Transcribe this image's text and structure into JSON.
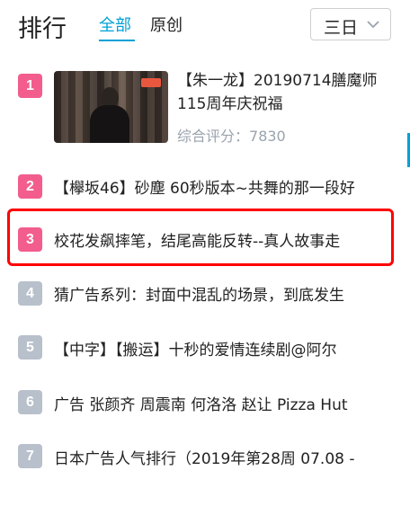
{
  "header": {
    "title": "排行",
    "tabs": [
      {
        "label": "全部",
        "active": true
      },
      {
        "label": "原创",
        "active": false
      }
    ],
    "period_select": {
      "value": "三日"
    }
  },
  "ranking": [
    {
      "rank": "1",
      "title": "【朱一龙】20190714膳魔师115周年庆祝福",
      "score_label": "综合评分：",
      "score": "7830"
    },
    {
      "rank": "2",
      "title": "【欅坂46】砂塵 60秒版本~共舞的那一段好"
    },
    {
      "rank": "3",
      "title": "校花发飙摔笔，结尾高能反转--真人故事走"
    },
    {
      "rank": "4",
      "title": "猜广告系列：封面中混乱的场景，到底发生"
    },
    {
      "rank": "5",
      "title": "【中字】【搬运】十秒的爱情连续剧@阿尔"
    },
    {
      "rank": "6",
      "title": "广告 张颜齐 周震南 何洛洛 赵让 Pizza Hut"
    },
    {
      "rank": "7",
      "title": "日本广告人气排行（2019年第28周 07.08 -"
    }
  ],
  "colors": {
    "accent": "#00a1d6",
    "rank_top": "#f25d8e",
    "rank_other": "#b8c0cc",
    "highlight": "#ff0000"
  }
}
